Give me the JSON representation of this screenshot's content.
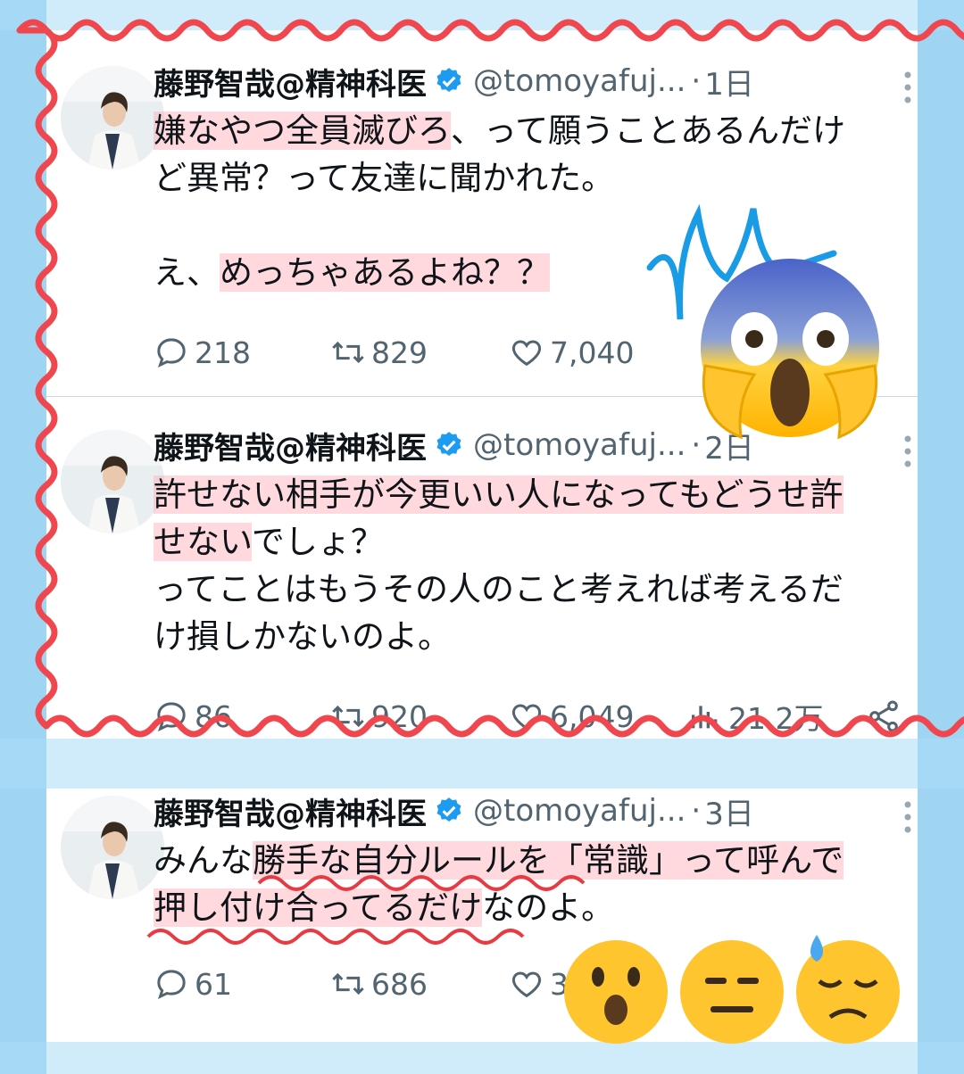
{
  "tweets": [
    {
      "name": "藤野智哉@精神科医",
      "handle": "@tomoyafuj...",
      "dot": "·",
      "time": "1日",
      "line1_hl": "嫌なやつ全員滅びろ",
      "line1_rest": "、って願うことあるんだけ",
      "line2": "ど異常？って友達に聞かれた。",
      "line3_pre": "え、",
      "line3_hl": "めっちゃあるよね？？",
      "replies": "218",
      "retweets": "829",
      "likes": "7,040"
    },
    {
      "name": "藤野智哉@精神科医",
      "handle": "@tomoyafuj...",
      "dot": "·",
      "time": "2日",
      "line1_hl": "許せない相手が今更いい人になってもどうせ許",
      "line2_hl": "せない",
      "line2_rest": "でしょ？",
      "line3": "ってことはもうその人のこと考えれば考えるだ",
      "line4": "け損しかないのよ。",
      "replies": "86",
      "retweets": "920",
      "likes": "6,049",
      "views": "21.2万"
    },
    {
      "name": "藤野智哉@精神科医",
      "handle": "@tomoyafuj...",
      "dot": "·",
      "time": "3日",
      "line1_pre": "みんな",
      "line1_hl": "勝手な自分ルールを「常識」って呼んで",
      "line2_hl": "押し付け合ってるだけ",
      "line2_rest": "なのよ。",
      "replies": "61",
      "retweets": "686",
      "likes": "3"
    }
  ],
  "colors": {
    "border_red": "#f0464e",
    "highlight": "#ffb3bd",
    "verified_blue": "#1d9bf0",
    "accent_line": "#1a9be6"
  },
  "icons": [
    "reply-icon",
    "retweet-icon",
    "like-icon",
    "views-icon",
    "share-icon",
    "verified-icon",
    "more-icon",
    "screaming-face-emoji",
    "hushed-face-emoji",
    "expressionless-face-emoji",
    "downcast-sweat-face-emoji"
  ]
}
